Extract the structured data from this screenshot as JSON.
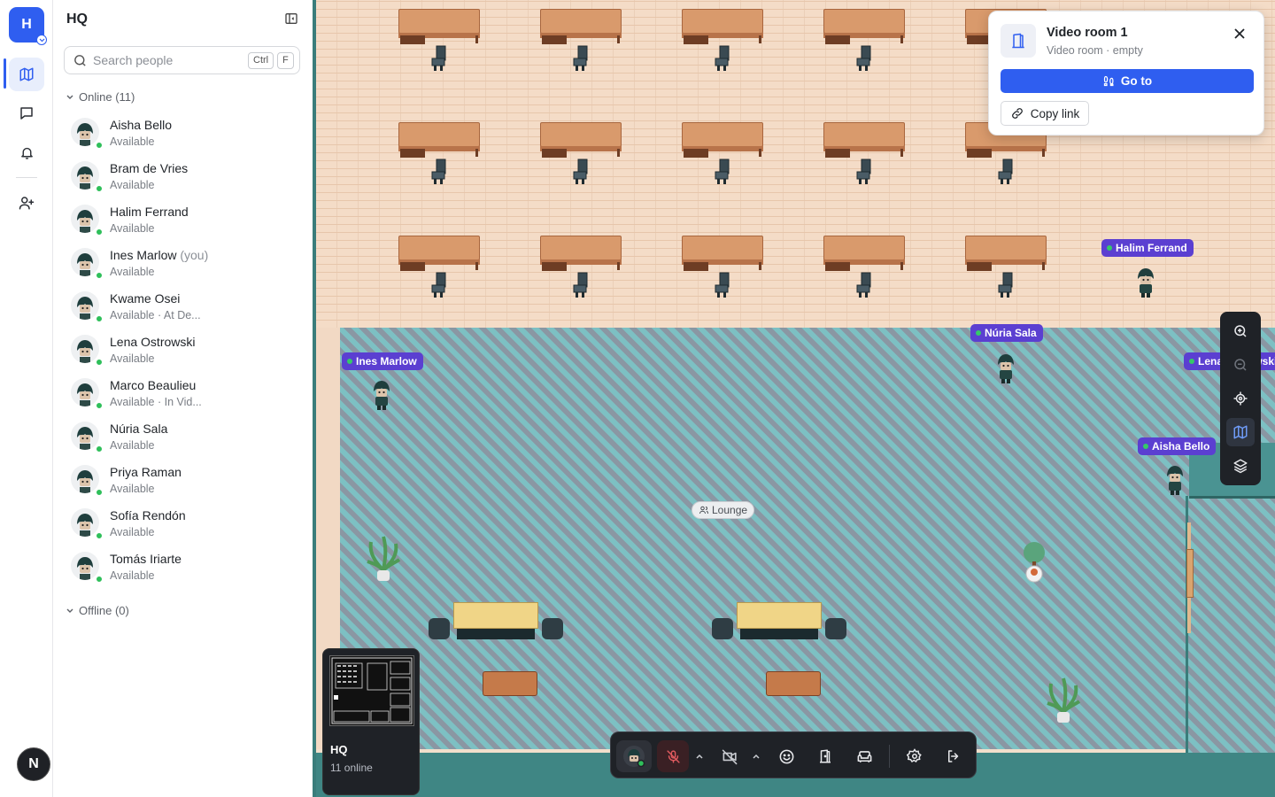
{
  "workspace": {
    "initial": "H",
    "user_initial": "N"
  },
  "panel": {
    "title": "HQ",
    "search_placeholder": "Search people",
    "shortcut_ctrl": "Ctrl",
    "shortcut_key": "F",
    "online_label": "Online (11)",
    "offline_label": "Offline (0)",
    "people": [
      {
        "name": "Aisha Bello",
        "you": "",
        "status": "Available"
      },
      {
        "name": "Bram de Vries",
        "you": "",
        "status": "Available"
      },
      {
        "name": "Halim Ferrand",
        "you": "",
        "status": "Available"
      },
      {
        "name": "Ines Marlow",
        "you": "(you)",
        "status": "Available"
      },
      {
        "name": "Kwame Osei",
        "you": "",
        "status": "Available · At De..."
      },
      {
        "name": "Lena Ostrowski",
        "you": "",
        "status": "Available"
      },
      {
        "name": "Marco Beaulieu",
        "you": "",
        "status": "Available · In Vid..."
      },
      {
        "name": "Núria Sala",
        "you": "",
        "status": "Available"
      },
      {
        "name": "Priya Raman",
        "you": "",
        "status": "Available"
      },
      {
        "name": "Sofía Rendón",
        "you": "",
        "status": "Available"
      },
      {
        "name": "Tomás Iriarte",
        "you": "",
        "status": "Available"
      }
    ]
  },
  "map": {
    "room_label": "Lounge",
    "tags": {
      "halim": "Halim Ferrand",
      "nuria": "Núria Sala",
      "ines": "Ines Marlow",
      "lena": "Lena Ostrowski",
      "aisha": "Aisha Bello"
    }
  },
  "minimap": {
    "name": "HQ",
    "count": "11 online"
  },
  "popup": {
    "title": "Video room 1",
    "subtitle": "Video room · empty",
    "goto_label": "Go to",
    "copy_label": "Copy link"
  },
  "colors": {
    "accent": "#2f5ef0",
    "nametag": "#5b3fd1",
    "online": "#2fbf5a"
  }
}
